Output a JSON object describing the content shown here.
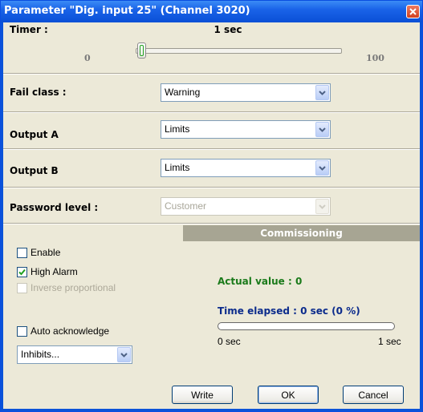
{
  "window": {
    "title": "Parameter \"Dig. input 25\" (Channel 3020)"
  },
  "timer": {
    "label": "Timer :",
    "value": "1 sec",
    "min_label": "0",
    "max_label": "100",
    "slider_fraction": 0.01
  },
  "fail_class": {
    "label": "Fail class :",
    "value": "Warning"
  },
  "output_a": {
    "label": "Output A",
    "value": "Limits"
  },
  "output_b": {
    "label": "Output B",
    "value": "Limits"
  },
  "password_level": {
    "label": "Password level :",
    "value": "Customer"
  },
  "checkboxes": {
    "enable": {
      "label": "Enable",
      "checked": false
    },
    "high_alarm": {
      "label": "High Alarm",
      "checked": true
    },
    "inverse_proportional": {
      "label": "Inverse proportional",
      "checked": false
    },
    "auto_acknowledge": {
      "label": "Auto acknowledge",
      "checked": false
    }
  },
  "inhibits": {
    "value": "Inhibits..."
  },
  "commissioning": {
    "header": "Commissioning",
    "actual_value": "Actual value : 0",
    "time_elapsed": "Time elapsed : 0 sec (0 %)",
    "progress_percent": 0,
    "progress_min_label": "0 sec",
    "progress_max_label": "1 sec"
  },
  "buttons": {
    "write": "Write",
    "ok": "OK",
    "cancel": "Cancel"
  },
  "colors": {
    "title_bar": "#0b53d8",
    "actual_value": "#1a7a1a",
    "time_elapsed": "#0b2b8c",
    "commissioning_header": "#a7a593"
  }
}
